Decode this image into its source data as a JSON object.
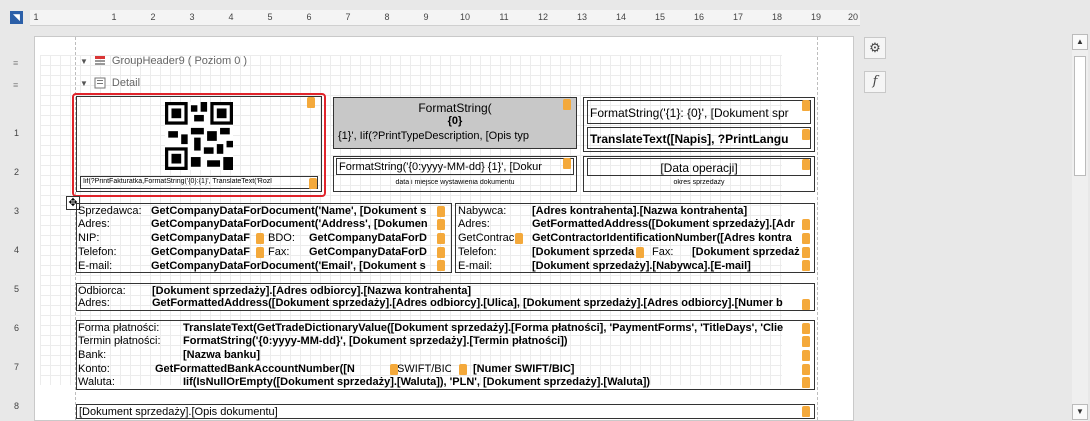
{
  "ruler": {
    "corner": "◥",
    "ticks": [
      "1",
      "1",
      "2",
      "3",
      "4",
      "5",
      "6",
      "7",
      "8",
      "9",
      "10",
      "11",
      "12",
      "13",
      "14",
      "15",
      "16",
      "17",
      "18",
      "19",
      "20"
    ],
    "left_ticks": [
      "1",
      "2",
      "3",
      "4",
      "5",
      "6",
      "7",
      "8"
    ]
  },
  "bands": {
    "group_header": "GroupHeader9 ( Poziom 0 )",
    "detail": "Detail"
  },
  "qr_block": {
    "footer": "Iif(?PrintFakturatka,FormatString('{0}:{1}', TranslateText('Rozl"
  },
  "fmt_gray": {
    "line1": "FormatString(",
    "line2": "{0}",
    "line3": "{1}', Iif(?PrintTypeDescription, [Opis typ"
  },
  "fmt_right": {
    "line1": "FormatString('{1}: {0}', [Dokument spr",
    "line2": "TranslateText([Napis], ?PrintLangu"
  },
  "date_box": {
    "value": "FormatString('{0:yyyy-MM-dd} {1}', [Dokur",
    "caption": "data i miejsce wystawienia dokumentu"
  },
  "oper_box": {
    "value": "[Data operacji]",
    "caption": "okres sprzedaży"
  },
  "seller": {
    "labels": [
      "Sprzedawca:",
      "Adres:",
      "NIP:",
      "Telefon:",
      "E-mail:"
    ],
    "values": [
      "GetCompanyDataForDocument('Name', [Dokument s",
      "GetCompanyDataForDocument('Address', [Dokumen",
      "GetCompanyDataF",
      "GetCompanyDataF",
      "GetCompanyDataForDocument('Email', [Dokument s"
    ],
    "bdo_label": "BDO:",
    "bdo_value": "GetCompanyDataForD",
    "fax_label": "Fax:",
    "fax_value": "GetCompanyDataForD"
  },
  "buyer": {
    "labels": [
      "Nabywca:",
      "Adres:",
      "GetContrac",
      "Telefon:",
      "E-mail:"
    ],
    "values": [
      "[Adres kontrahenta].[Nazwa kontrahenta]",
      "GetFormattedAddress([Dokument sprzedaży].[Adr",
      "GetContractorIdentificationNumber([Adres kontra",
      "[Dokument sprzeda",
      "[Dokument sprzedaży].[Nabywca].[E-mail]"
    ],
    "fax_label": "Fax:",
    "fax_value": "[Dokument sprzedaż"
  },
  "recipient": {
    "labels": [
      "Odbiorca:",
      "Adres:"
    ],
    "values": [
      "[Dokument sprzedaży].[Adres odbiorcy].[Nazwa kontrahenta]",
      "GetFormattedAddress([Dokument sprzedaży].[Adres odbiorcy].[Ulica], [Dokument sprzedaży].[Adres odbiorcy].[Numer b"
    ]
  },
  "payment": {
    "labels": [
      "Forma płatności:",
      "Termin płatności:",
      "Bank:",
      "Konto:",
      "Waluta:"
    ],
    "values": [
      "TranslateText(GetTradeDictionaryValue([Dokument sprzedaży].[Forma płatności], 'PaymentForms', 'TitleDays', 'Clie",
      "FormatString('{0:yyyy-MM-dd}', [Dokument sprzedaży].[Termin płatności])",
      "[Nazwa banku]",
      "GetFormattedBankAccountNumber([N",
      "Iif(IsNullOrEmpty([Dokument sprzedaży].[Waluta]), 'PLN', [Dokument sprzedaży].[Waluta])"
    ],
    "swift_label": "SWIFT/BIC",
    "swift_value": "[Numer SWIFT/BIC]"
  },
  "description": "[Dokument sprzedaży].[Opis dokumentu]",
  "side": {
    "settings": "⚙",
    "function": "f"
  },
  "colors": {
    "selection": "#e0242b",
    "tag": "#f4a93b",
    "gray_box": "#c8c8c8"
  }
}
